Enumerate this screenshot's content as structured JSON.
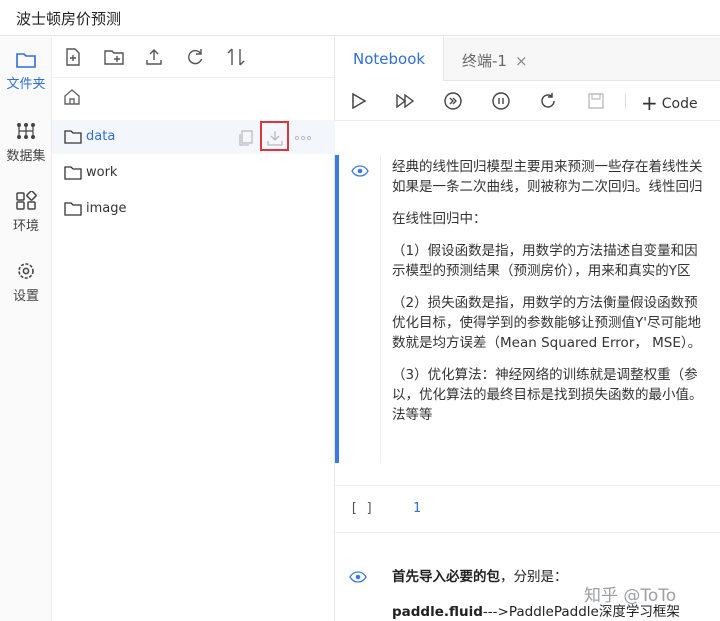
{
  "app": {
    "title": "波士顿房价预测"
  },
  "leftbar": {
    "items": [
      {
        "label": "文件夹",
        "icon": "folder-icon",
        "active": true
      },
      {
        "label": "数据集",
        "icon": "dataset-icon"
      },
      {
        "label": "环境",
        "icon": "grid-icon"
      },
      {
        "label": "设置",
        "icon": "gear-icon"
      }
    ]
  },
  "filepanel": {
    "toolbar": [
      "new-file-icon",
      "new-folder-icon",
      "upload-icon",
      "refresh-icon",
      "sort-icon"
    ],
    "files": [
      {
        "name": "data",
        "selected": true
      },
      {
        "name": "work"
      },
      {
        "name": "image"
      }
    ]
  },
  "tabs": [
    {
      "label": "Notebook",
      "active": true
    },
    {
      "label": "终端-1",
      "close": "×"
    }
  ],
  "nb_toolbar": {
    "code_label": "Code",
    "code_plus": "+"
  },
  "cells": {
    "md1": {
      "p1a": "经典的线性回归模型主要用来预测一些存在着线性关",
      "p1b": "如果是一条二次曲线，则被称为二次回归。线性回归",
      "p2": "在线性回归中：",
      "p3a": "（1）假设函数是指，用数学的方法描述自变量和因",
      "p3b": "示模型的预测结果（预测房价），用来和真实的Y区",
      "p4a": "（2）损失函数是指，用数学的方法衡量假设函数预",
      "p4b": "优化目标，使得学到的参数能够让预测值Y'尽可能地",
      "p4c": "数就是均方误差（Mean Squared Error， MSE）。",
      "p5a": "（3）优化算法：神经网络的训练就是调整权重（参",
      "p5b": "以，优化算法的最终目标是找到损失函数的最小值。",
      "p5c": "法等等"
    },
    "code1": {
      "prompt": "[ ]",
      "line": "1"
    },
    "md2": {
      "bold1": "首先导入必要的包",
      "rest1": "，分别是：",
      "bold2": "paddle.fluid",
      "rest2": "--->PaddlePaddle深度学习框架"
    }
  },
  "watermark": "知乎 @ToTo",
  "colors": {
    "accent": "#2f6fd6",
    "highlight_box": "#d9363e",
    "cell_bar": "#3b7be0"
  }
}
